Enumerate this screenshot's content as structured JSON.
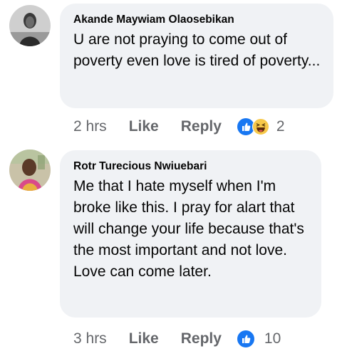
{
  "comments": [
    {
      "author": "Akande Maywiam Olaosebikan",
      "text": "U are not praying to come out of poverty even love is tired of poverty...",
      "time": "2 hrs",
      "like_label": "Like",
      "reply_label": "Reply",
      "reactions": [
        "like-icon",
        "haha-icon"
      ],
      "reaction_count": "2"
    },
    {
      "author": "Rotr Turecious Nwiuebari",
      "text": "Me that I hate myself when I'm broke like this. I pray for alart that will change your life because that's the most important and not love. Love can come later.",
      "time": "3 hrs",
      "like_label": "Like",
      "reply_label": "Reply",
      "reactions": [
        "like-icon"
      ],
      "reaction_count": "10"
    }
  ],
  "colors": {
    "bubble_bg": "#f0f2f5",
    "meta_text": "#65676b",
    "like_blue": "#1877f2",
    "haha_yellow": "#f7c84a"
  }
}
